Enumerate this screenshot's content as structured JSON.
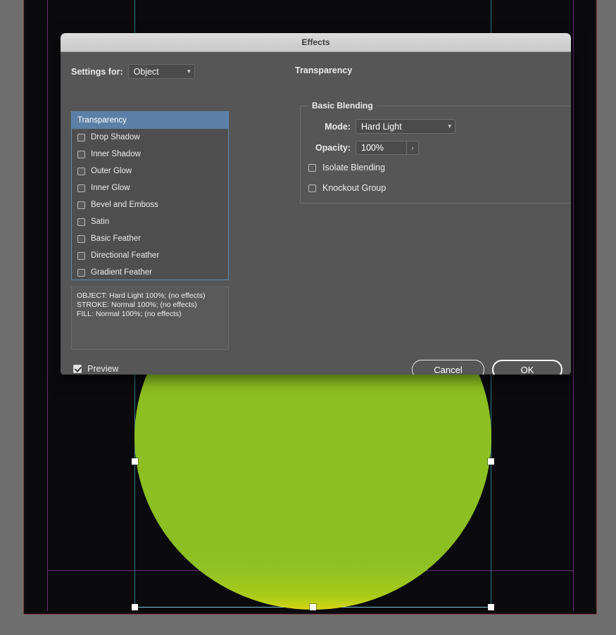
{
  "dialog": {
    "title": "Effects",
    "settings_for_label": "Settings for:",
    "settings_for_value": "Object",
    "pane_title": "Transparency",
    "chevron_icon": "chevron-down-icon"
  },
  "effects_list": [
    {
      "label": "Transparency",
      "selected": true,
      "checkbox": false
    },
    {
      "label": "Drop Shadow",
      "selected": false,
      "checkbox": false
    },
    {
      "label": "Inner Shadow",
      "selected": false,
      "checkbox": false
    },
    {
      "label": "Outer Glow",
      "selected": false,
      "checkbox": false
    },
    {
      "label": "Inner Glow",
      "selected": false,
      "checkbox": false
    },
    {
      "label": "Bevel and Emboss",
      "selected": false,
      "checkbox": false
    },
    {
      "label": "Satin",
      "selected": false,
      "checkbox": false
    },
    {
      "label": "Basic Feather",
      "selected": false,
      "checkbox": false
    },
    {
      "label": "Directional Feather",
      "selected": false,
      "checkbox": false
    },
    {
      "label": "Gradient Feather",
      "selected": false,
      "checkbox": false
    }
  ],
  "summary": {
    "line1": "OBJECT: Hard Light 100%; (no effects)",
    "line2": "STROKE: Normal 100%; (no effects)",
    "line3": "FILL: Normal 100%; (no effects)"
  },
  "basic_blending": {
    "legend": "Basic Blending",
    "mode_label": "Mode:",
    "mode_value": "Hard Light",
    "opacity_label": "Opacity:",
    "opacity_value": "100%",
    "stepper_icon": "chevron-right-icon",
    "isolate_blending_label": "Isolate Blending",
    "isolate_blending_checked": false,
    "knockout_group_label": "Knockout Group",
    "knockout_group_checked": false
  },
  "footer": {
    "preview_label": "Preview",
    "preview_checked": true,
    "cancel_label": "Cancel",
    "ok_label": "OK"
  },
  "colors": {
    "dialog_bg": "#565656",
    "titlebar_bg": "#d0d0d0",
    "selection_blue": "#5b7fa6",
    "shape_green": "#8cbf21",
    "shape_green_bottom": "#d6d616",
    "canvas_bg": "#0a0a0d",
    "app_bg": "#6e6e6e",
    "guide_magenta": "#7b2f8f",
    "guide_cyan": "#79c6d4",
    "page_border_red": "#7d3f42"
  },
  "canvas": {
    "shape_name": "green-ellipse-object",
    "selected": true
  }
}
